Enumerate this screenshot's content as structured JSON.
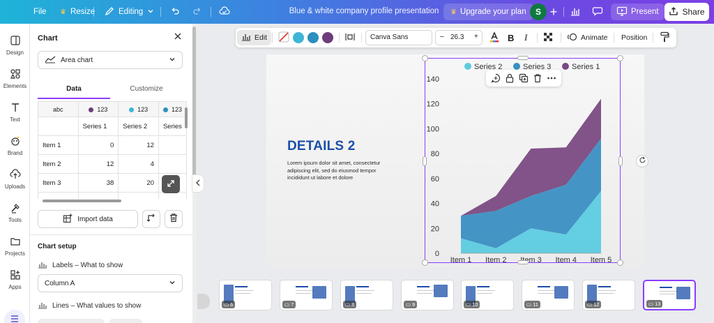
{
  "topbar": {
    "file": "File",
    "resize": "Resize",
    "editing": "Editing",
    "title": "Blue & white company profile presentation",
    "upgrade": "Upgrade your plan",
    "avatar_initial": "S",
    "present": "Present",
    "share": "Share"
  },
  "rail": {
    "items": [
      {
        "label": "Design",
        "icon": "design-icon"
      },
      {
        "label": "Elements",
        "icon": "elements-icon"
      },
      {
        "label": "Text",
        "icon": "text-icon"
      },
      {
        "label": "Brand",
        "icon": "brand-icon"
      },
      {
        "label": "Uploads",
        "icon": "uploads-icon"
      },
      {
        "label": "Tools",
        "icon": "tools-icon"
      },
      {
        "label": "Projects",
        "icon": "projects-icon"
      },
      {
        "label": "Apps",
        "icon": "apps-icon"
      }
    ]
  },
  "panel": {
    "title": "Chart",
    "chart_type": "Area chart",
    "tabs": [
      "Data",
      "Customize"
    ],
    "grid": {
      "header_row": [
        "abc",
        "123",
        "123",
        "123"
      ],
      "series_row": [
        "",
        "Series 1",
        "Series 2",
        "Series"
      ],
      "rows": [
        [
          "Item 1",
          "0",
          "12",
          ""
        ],
        [
          "Item 2",
          "12",
          "4",
          ""
        ],
        [
          "Item 3",
          "38",
          "20",
          ""
        ]
      ]
    },
    "import_label": "Import data",
    "setup_title": "Chart setup",
    "labels_label": "Labels – What to show",
    "labels_value": "Column A",
    "lines_label": "Lines – What values to show"
  },
  "toolbar": {
    "edit": "Edit",
    "font": "Canva Sans",
    "size": "26.3",
    "minus": "–",
    "plus": "+",
    "bold": "B",
    "italic": "I",
    "animate": "Animate",
    "position": "Position"
  },
  "colors": {
    "accent": "#8b3dff",
    "series1": "#7a4a82",
    "series2": "#5ccbe0",
    "series3": "#3a8fc2",
    "swatch1": "#3fb5d6",
    "swatch2": "#2d8fc0",
    "swatch3": "#6c3d7a",
    "title_blue": "#1b4fa8"
  },
  "slide": {
    "heading": "DETAILS 2",
    "body": "Lorem ipsum dolor sit amet, consectetur adipiscing elit, sed do eiusmod tempor incididunt ut labore et dolore"
  },
  "chart_data": {
    "type": "area",
    "stacked": true,
    "categories": [
      "Item 1",
      "Item 2",
      "Item 3",
      "Item 4",
      "Item 5"
    ],
    "series": [
      {
        "name": "Series 2",
        "values": [
          12,
          4,
          20,
          15,
          50
        ],
        "color": "#5ccbe0"
      },
      {
        "name": "Series 3",
        "values": [
          18,
          30,
          26,
          40,
          42
        ],
        "color": "#3a8fc2"
      },
      {
        "name": "Series 1",
        "values": [
          0,
          12,
          38,
          30,
          32
        ],
        "color": "#7a4a82"
      }
    ],
    "yticks": [
      0,
      20,
      40,
      60,
      80,
      100,
      120,
      140
    ],
    "ylim": [
      0,
      140
    ],
    "legend": "top",
    "grid": false
  },
  "filmstrip": {
    "slides": [
      "6",
      "7",
      "8",
      "9",
      "10",
      "11",
      "12",
      "13"
    ],
    "active": "13"
  }
}
